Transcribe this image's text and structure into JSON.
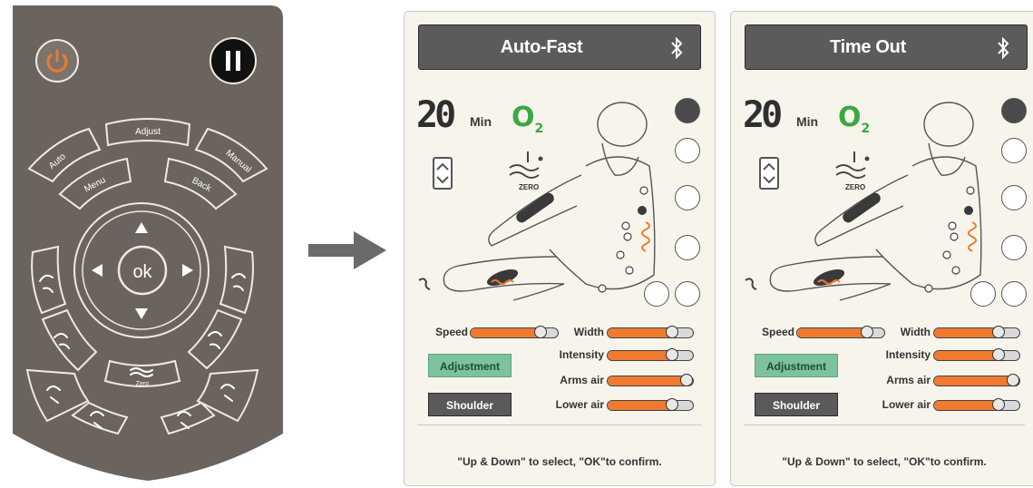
{
  "remote": {
    "power_icon": "power-icon",
    "pause_icon": "pause-icon",
    "buttons": {
      "auto": "Auto",
      "adjust": "Adjust",
      "manual": "Manual",
      "menu": "Menu",
      "back": "Back",
      "ok": "ok",
      "zero": "Zero"
    }
  },
  "panels": [
    {
      "title": "Auto-Fast",
      "time_value": "20",
      "time_unit": "Min",
      "o2_label": "O",
      "o2_sub": "2",
      "zero_label": "ZERO",
      "sliders": {
        "speed": {
          "label": "Speed",
          "level": 0.8
        },
        "width": {
          "label": "Width",
          "level": 0.75
        },
        "intensity": {
          "label": "Intensity",
          "level": 0.75
        },
        "arms_air": {
          "label": "Arms air",
          "level": 0.95
        },
        "lower_air": {
          "label": "Lower air",
          "level": 0.75
        }
      },
      "adjustment_label": "Adjustment",
      "shoulder_label": "Shoulder",
      "hint": "\"Up & Down\" to select, \"OK\"to confirm."
    },
    {
      "title": "Time Out",
      "time_value": "20",
      "time_unit": "Min",
      "o2_label": "O",
      "o2_sub": "2",
      "zero_label": "ZERO",
      "sliders": {
        "speed": {
          "label": "Speed",
          "level": 0.8
        },
        "width": {
          "label": "Width",
          "level": 0.75
        },
        "intensity": {
          "label": "Intensity",
          "level": 0.75
        },
        "arms_air": {
          "label": "Arms air",
          "level": 0.95
        },
        "lower_air": {
          "label": "Lower air",
          "level": 0.75
        }
      },
      "adjustment_label": "Adjustment",
      "shoulder_label": "Shoulder",
      "hint": "\"Up & Down\" to select, \"OK\"to confirm."
    }
  ],
  "colors": {
    "remote_body": "#6b645e",
    "accent_orange": "#f07a2e",
    "o2_green": "#3aa845",
    "adjust_green": "#7bc29d",
    "title_bar": "#5b5b5b"
  }
}
